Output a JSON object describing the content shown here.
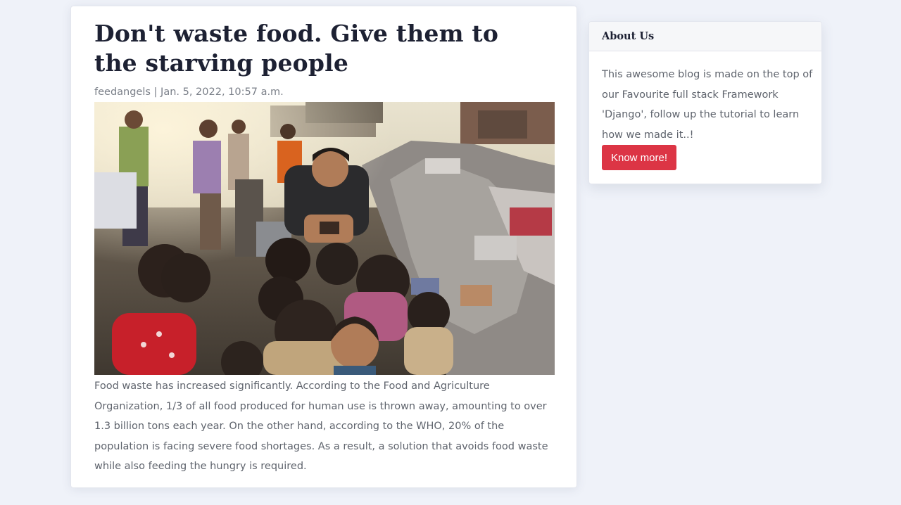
{
  "post": {
    "title": "Don't waste food. Give them to the starving people",
    "meta": "feedangels | Jan. 5, 2022, 10:57 a.m.",
    "image_alt": "Children gathered around a man in a slum next to a pile of waste",
    "body": "Food waste has increased significantly. According to the Food and Agriculture Organization, 1/3 of all food produced for human use is thrown away, amounting to over 1.3 billion tons each year. On the other hand, according to the WHO, 20% of the population is facing severe food shortages. As a result, a solution that avoids food waste while also feeding the hungry is required."
  },
  "sidebar": {
    "about": {
      "header": "About Us",
      "text": "This awesome blog is made on the top of our Favourite full stack Framework 'Django', follow up the tutorial to learn how we made it..!",
      "button_label": "Know more!"
    }
  },
  "colors": {
    "page_background": "#eff2f9",
    "heading": "#1d2133",
    "body_text": "#5f646d",
    "button_primary": "#dc3545"
  }
}
